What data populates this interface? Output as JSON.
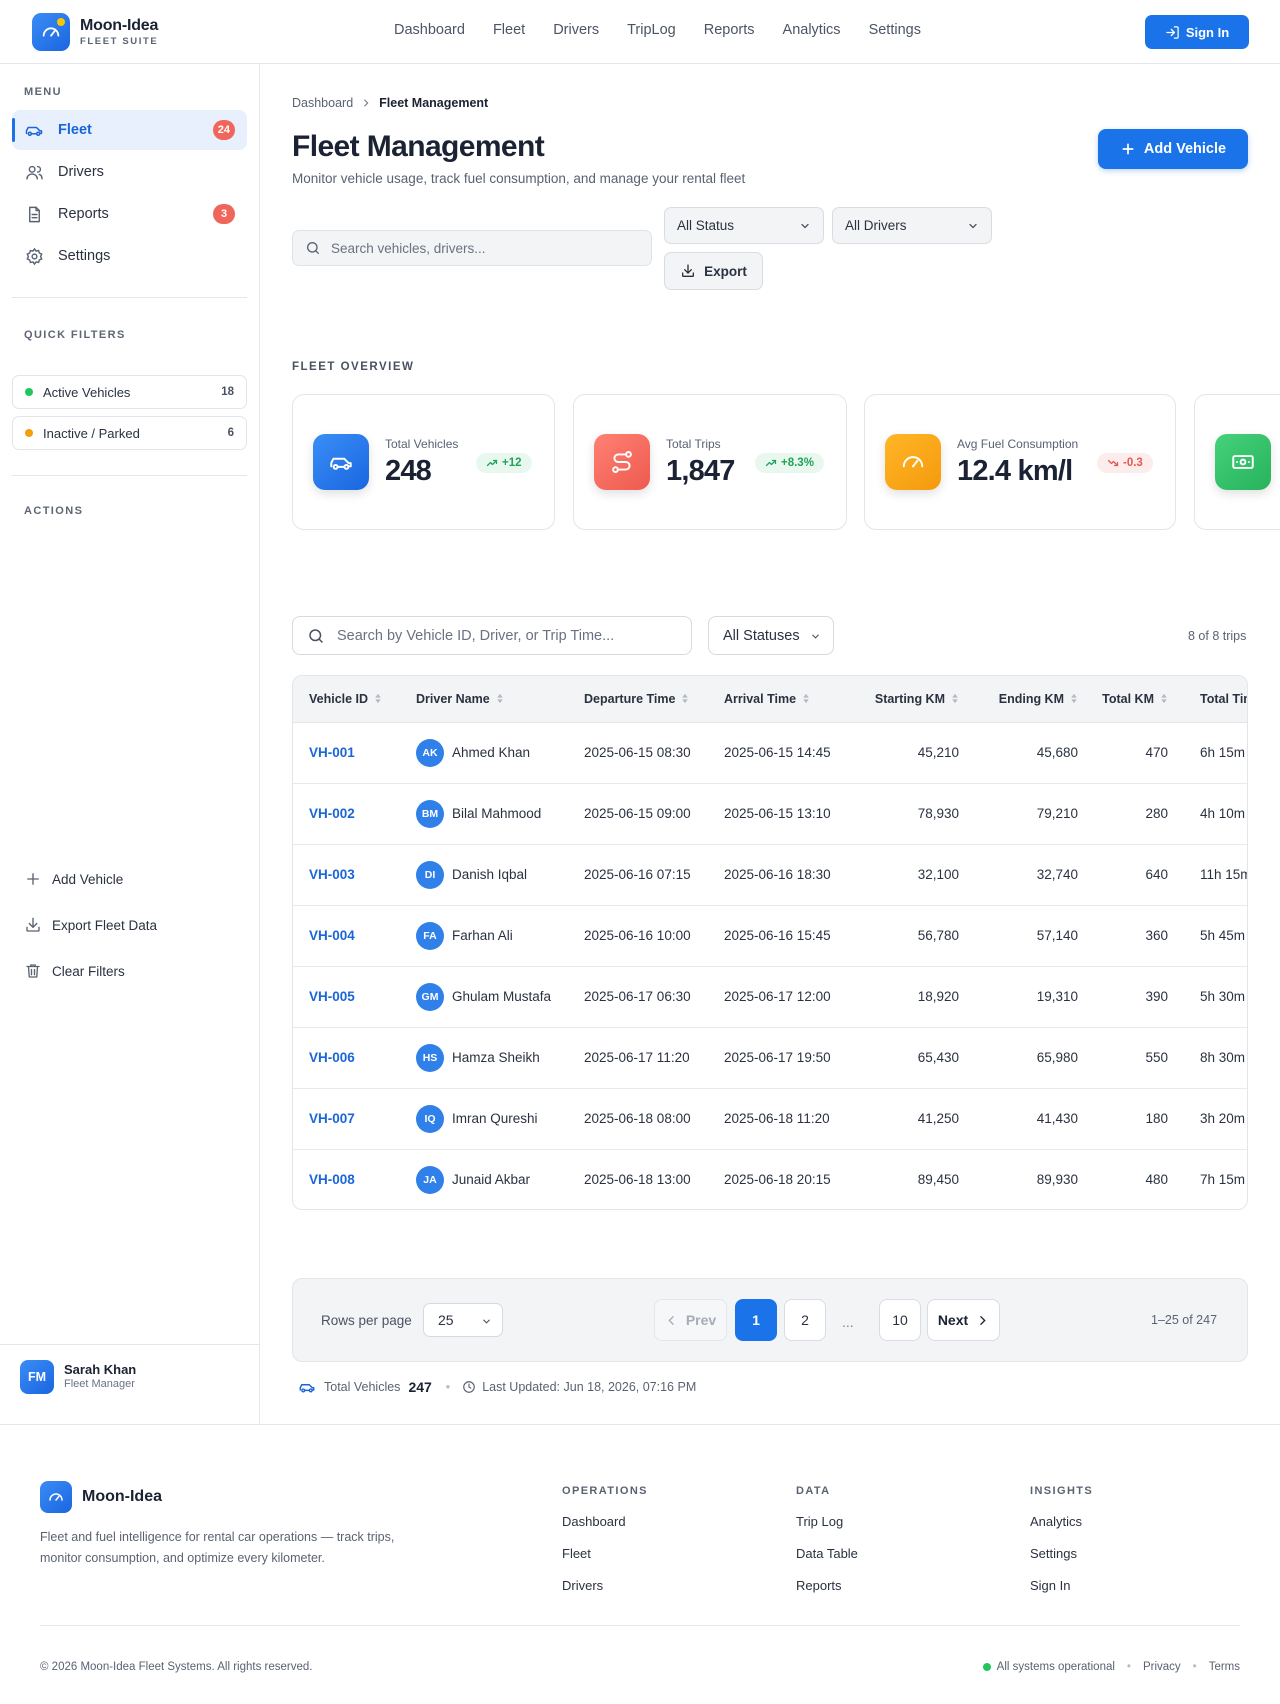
{
  "header": {
    "brand_name": "Moon-Idea",
    "brand_sub": "FLEET SUITE",
    "nav": [
      "Dashboard",
      "Fleet",
      "Drivers",
      "TripLog",
      "Reports",
      "Analytics",
      "Settings"
    ],
    "signin_label": "Sign In"
  },
  "sidebar": {
    "menu_heading": "MENU",
    "items": [
      {
        "label": "Fleet",
        "icon": "car-icon",
        "badge": "24",
        "active": true
      },
      {
        "label": "Drivers",
        "icon": "users-icon"
      },
      {
        "label": "Reports",
        "icon": "document-icon",
        "badge": "3"
      },
      {
        "label": "Settings",
        "icon": "gear-icon"
      }
    ],
    "quick_filters_heading": "QUICK FILTERS",
    "quick_filters": [
      {
        "label": "Active Vehicles",
        "count": "18",
        "color": "#22c55e"
      },
      {
        "label": "Inactive / Parked",
        "count": "6",
        "color": "#f59e0b"
      }
    ],
    "actions_heading": "ACTIONS",
    "actions": [
      {
        "label": "Add Vehicle",
        "icon": "plus-icon"
      },
      {
        "label": "Export Fleet Data",
        "icon": "download-icon"
      },
      {
        "label": "Clear Filters",
        "icon": "trash-icon"
      }
    ],
    "user": {
      "initials": "FM",
      "name": "Sarah Khan",
      "role": "Fleet Manager"
    }
  },
  "main": {
    "breadcrumb": [
      "Dashboard",
      "Fleet Management"
    ],
    "title": "Fleet Management",
    "subtitle": "Monitor vehicle usage, track fuel consumption, and manage your rental fleet",
    "add_vehicle_label": "Add Vehicle",
    "search_placeholder": "Search vehicles, drivers...",
    "status_filter": "All Status",
    "driver_filter": "All Drivers",
    "export_label": "Export",
    "overview_heading": "FLEET OVERVIEW",
    "stats": [
      {
        "label": "Total Vehicles",
        "value": "248",
        "trend": "+12",
        "direction": "up",
        "icon": "car-icon",
        "color": "#2f7ff0"
      },
      {
        "label": "Total Trips",
        "value": "1,847",
        "trend": "+8.3%",
        "direction": "up",
        "icon": "route-icon",
        "color": "#f26b5f"
      },
      {
        "label": "Avg Fuel Consumption",
        "value": "12.4 km/l",
        "trend": "-0.3",
        "direction": "down",
        "icon": "gauge-icon",
        "color": "#f7a81b"
      },
      {
        "icon": "cash-icon",
        "color": "#34c26a"
      }
    ],
    "table_search_placeholder": "Search by Vehicle ID, Driver, or Trip Time...",
    "table_status_filter": "All Statuses",
    "trips_count": "8 of 8 trips",
    "columns": [
      "Vehicle ID",
      "Driver Name",
      "Departure Time",
      "Arrival Time",
      "Starting KM",
      "Ending KM",
      "Total KM",
      "Total Time"
    ],
    "rows": [
      {
        "id": "VH-001",
        "initials": "AK",
        "driver": "Ahmed Khan",
        "dep": "2025-06-15 08:30",
        "arr": "2025-06-15 14:45",
        "start": "45,210",
        "end": "45,680",
        "total": "470",
        "time": "6h 15m"
      },
      {
        "id": "VH-002",
        "initials": "BM",
        "driver": "Bilal Mahmood",
        "dep": "2025-06-15 09:00",
        "arr": "2025-06-15 13:10",
        "start": "78,930",
        "end": "79,210",
        "total": "280",
        "time": "4h 10m"
      },
      {
        "id": "VH-003",
        "initials": "DI",
        "driver": "Danish Iqbal",
        "dep": "2025-06-16 07:15",
        "arr": "2025-06-16 18:30",
        "start": "32,100",
        "end": "32,740",
        "total": "640",
        "time": "11h 15m"
      },
      {
        "id": "VH-004",
        "initials": "FA",
        "driver": "Farhan Ali",
        "dep": "2025-06-16 10:00",
        "arr": "2025-06-16 15:45",
        "start": "56,780",
        "end": "57,140",
        "total": "360",
        "time": "5h 45m"
      },
      {
        "id": "VH-005",
        "initials": "GM",
        "driver": "Ghulam Mustafa",
        "dep": "2025-06-17 06:30",
        "arr": "2025-06-17 12:00",
        "start": "18,920",
        "end": "19,310",
        "total": "390",
        "time": "5h 30m"
      },
      {
        "id": "VH-006",
        "initials": "HS",
        "driver": "Hamza Sheikh",
        "dep": "2025-06-17 11:20",
        "arr": "2025-06-17 19:50",
        "start": "65,430",
        "end": "65,980",
        "total": "550",
        "time": "8h 30m"
      },
      {
        "id": "VH-007",
        "initials": "IQ",
        "driver": "Imran Qureshi",
        "dep": "2025-06-18 08:00",
        "arr": "2025-06-18 11:20",
        "start": "41,250",
        "end": "41,430",
        "total": "180",
        "time": "3h 20m"
      },
      {
        "id": "VH-008",
        "initials": "JA",
        "driver": "Junaid Akbar",
        "dep": "2025-06-18 13:00",
        "arr": "2025-06-18 20:15",
        "start": "89,450",
        "end": "89,930",
        "total": "480",
        "time": "7h 15m"
      }
    ],
    "pagination": {
      "rows_label": "Rows per page",
      "rows_value": "25",
      "prev": "Prev",
      "pages": [
        "1",
        "2",
        "10"
      ],
      "ellipsis": "...",
      "next": "Next",
      "range": "1–25 of 247"
    },
    "summary": {
      "label": "Total Vehicles",
      "value": "247",
      "updated": "Last Updated: Jun 18, 2026, 07:16 PM"
    }
  },
  "footer": {
    "brand": "Moon-Idea",
    "desc": "Fleet and fuel intelligence for rental car operations — track trips, monitor consumption, and optimize every kilometer.",
    "columns": [
      {
        "heading": "OPERATIONS",
        "links": [
          "Dashboard",
          "Fleet",
          "Drivers"
        ]
      },
      {
        "heading": "DATA",
        "links": [
          "Trip Log",
          "Data Table",
          "Reports"
        ]
      },
      {
        "heading": "INSIGHTS",
        "links": [
          "Analytics",
          "Settings",
          "Sign In"
        ]
      }
    ],
    "copyright": "© 2026 Moon-Idea Fleet Systems. All rights reserved.",
    "status": "All systems operational",
    "privacy": "Privacy",
    "terms": "Terms"
  }
}
